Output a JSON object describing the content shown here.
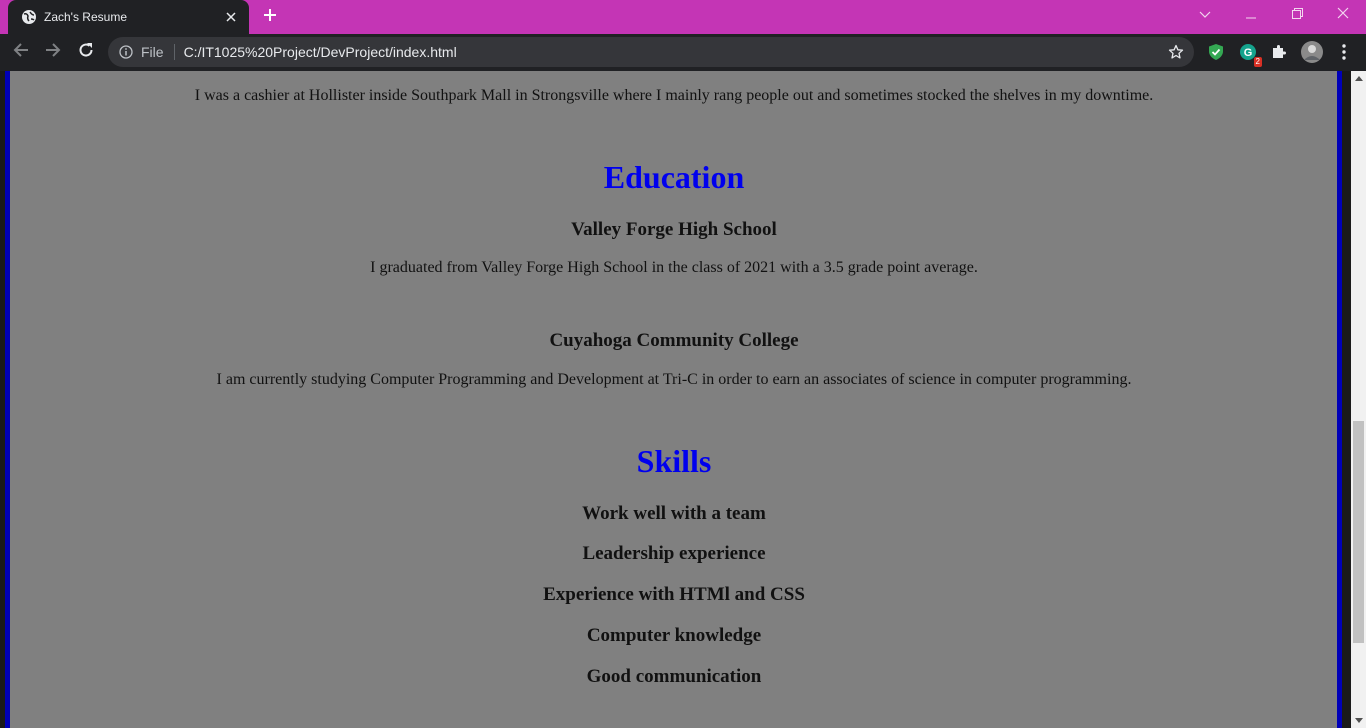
{
  "browser": {
    "tab_title": "Zach's Resume",
    "omnibox_scheme_label": "File",
    "url": "C:/IT1025%20Project/DevProject/index.html",
    "extension_badge": "2",
    "tab_strip_color": "#c435b5"
  },
  "page": {
    "work_description": "I was a cashier at Hollister inside Southpark Mall in Strongsville where I mainly rang people out and sometimes stocked the shelves in my downtime.",
    "education": {
      "heading": "Education",
      "schools": [
        {
          "name": "Valley Forge High School",
          "description": "I graduated from Valley Forge High School in the class of 2021 with a 3.5 grade point average."
        },
        {
          "name": "Cuyahoga Community College",
          "description": "I am currently studying Computer Programming and Development at Tri-C in order to earn an associates of science in computer programming."
        }
      ]
    },
    "skills": {
      "heading": "Skills",
      "items": [
        "Work well with a team",
        "Leadership experience",
        "Experience with HTMl and CSS",
        "Computer knowledge",
        "Good communication"
      ]
    },
    "colors": {
      "background": "#808080",
      "heading": "#0000ee",
      "border": "#0000b8"
    }
  },
  "icons": {
    "favicon": "globe-icon",
    "close": "close-icon",
    "new_tab": "plus-icon",
    "tab_search": "chevron-down-icon",
    "minimize": "minimize-icon",
    "restore": "restore-icon",
    "window_close": "close-icon",
    "back": "back-arrow-icon",
    "forward": "forward-arrow-icon",
    "reload": "reload-icon",
    "site_info": "info-icon",
    "bookmark": "star-icon",
    "extension_1": "shield-check-icon",
    "extension_2": "grammarly-icon",
    "extensions_menu": "puzzle-icon",
    "profile": "avatar-icon",
    "menu": "kebab-menu-icon"
  }
}
